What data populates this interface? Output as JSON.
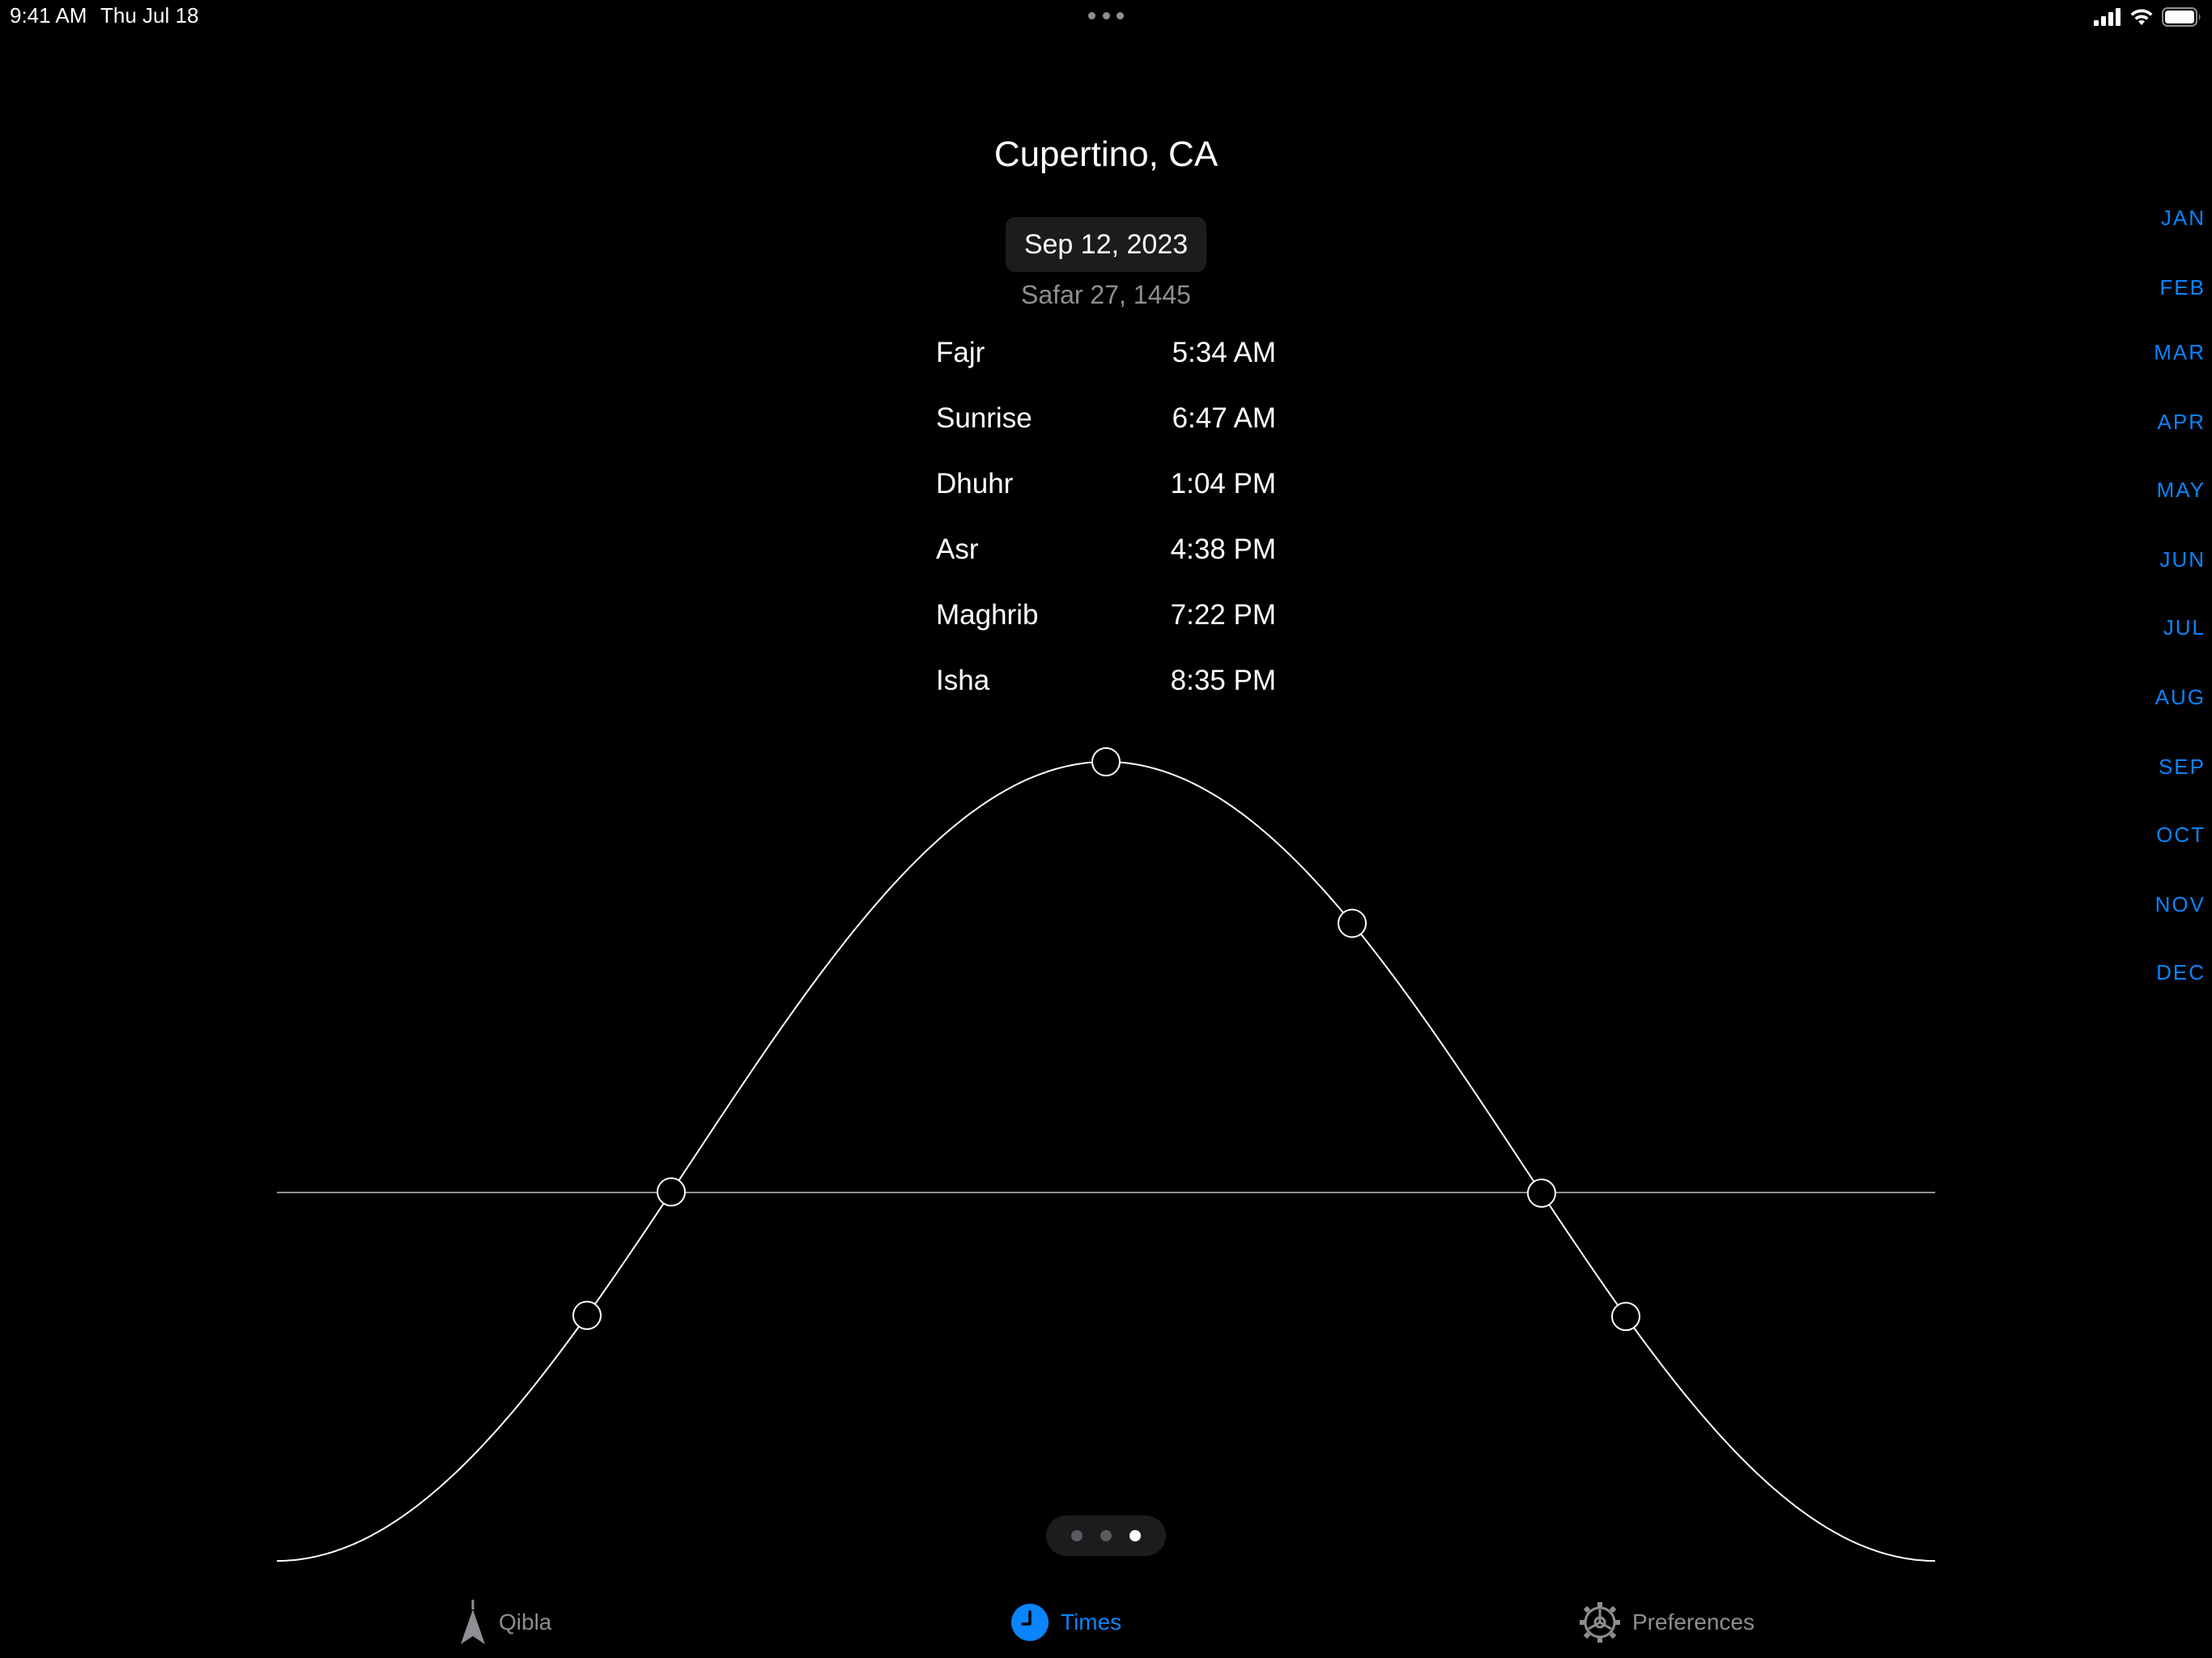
{
  "status_bar": {
    "time": "9:41 AM",
    "date": "Thu Jul 18",
    "icons": [
      "cellular-signal-icon",
      "wifi-icon",
      "battery-icon"
    ]
  },
  "header": {
    "location": "Cupertino, CA",
    "date": "Sep 12, 2023",
    "hijri_date": "Safar 27, 1445"
  },
  "prayers": [
    {
      "name": "Fajr",
      "time": "5:34 AM"
    },
    {
      "name": "Sunrise",
      "time": "6:47 AM"
    },
    {
      "name": "Dhuhr",
      "time": "1:04 PM"
    },
    {
      "name": "Asr",
      "time": "4:38 PM"
    },
    {
      "name": "Maghrib",
      "time": "7:22 PM"
    },
    {
      "name": "Isha",
      "time": "8:35 PM"
    }
  ],
  "months": [
    "JAN",
    "FEB",
    "MAR",
    "APR",
    "MAY",
    "JUN",
    "JUL",
    "AUG",
    "SEP",
    "OCT",
    "NOV",
    "DEC"
  ],
  "page_control": {
    "count": 3,
    "current": 3
  },
  "tabs": [
    {
      "label": "Qibla",
      "icon": "compass-arrow-icon",
      "selected": false
    },
    {
      "label": "Times",
      "icon": "clock-icon",
      "selected": true
    },
    {
      "label": "Preferences",
      "icon": "gear-icon",
      "selected": false
    }
  ],
  "colors": {
    "background": "#000000",
    "accent": "#0a84ff",
    "secondary_text": "#8e8e93",
    "curve": "#ffffff"
  },
  "chart_data": {
    "type": "line",
    "description_points": [
      "Fajr",
      "Sunrise",
      "Dhuhr",
      "Asr",
      "Maghrib",
      "Isha"
    ],
    "x": [
      "5:34 AM",
      "6:47 AM",
      "1:04 PM",
      "4:38 PM",
      "7:22 PM",
      "8:35 PM"
    ],
    "grid": false
  }
}
